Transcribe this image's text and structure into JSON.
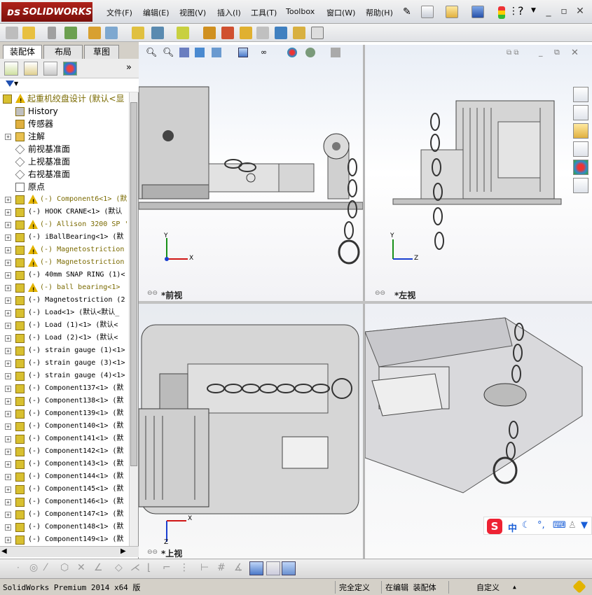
{
  "app": {
    "logo": "SOLIDWORKS",
    "menus": [
      "文件(F)",
      "编辑(E)",
      "视图(V)",
      "插入(I)",
      "工具(T)",
      "Toolbox",
      "窗口(W)",
      "帮助(H)"
    ],
    "window_controls": [
      "minimize-icon",
      "restore-icon",
      "close-icon"
    ]
  },
  "panel": {
    "tabs": [
      "装配体",
      "布局",
      "草图"
    ],
    "active_tab": "装配体",
    "collapse_symbol": "»"
  },
  "tree": [
    {
      "label": "起重机绞盘设计  (默认<显",
      "exp": "",
      "icon": "assembly",
      "warn": true,
      "color": "#7a6a00",
      "indent": 0
    },
    {
      "label": "History",
      "exp": "",
      "icon": "history",
      "warn": false,
      "color": "#000",
      "indent": 1
    },
    {
      "label": "传感器",
      "exp": "",
      "icon": "sensor",
      "warn": false,
      "color": "#000",
      "indent": 1
    },
    {
      "label": "注解",
      "exp": "+",
      "icon": "annotation",
      "warn": false,
      "color": "#000",
      "indent": 1
    },
    {
      "label": "前视基准面",
      "exp": "",
      "icon": "plane",
      "warn": false,
      "color": "#000",
      "indent": 1
    },
    {
      "label": "上视基准面",
      "exp": "",
      "icon": "plane",
      "warn": false,
      "color": "#000",
      "indent": 1
    },
    {
      "label": "右视基准面",
      "exp": "",
      "icon": "plane",
      "warn": false,
      "color": "#000",
      "indent": 1
    },
    {
      "label": "原点",
      "exp": "",
      "icon": "origin",
      "warn": false,
      "color": "#000",
      "indent": 1
    },
    {
      "label": "(-) Component6<1> (默",
      "exp": "+",
      "icon": "component",
      "warn": true,
      "color": "#7a6a00",
      "indent": 1
    },
    {
      "label": "(-) HOOK CRANE<1> (默认",
      "exp": "+",
      "icon": "component",
      "warn": false,
      "color": "#000",
      "indent": 1
    },
    {
      "label": "(-) Allison 3200 SP '",
      "exp": "+",
      "icon": "component",
      "warn": true,
      "color": "#7a6a00",
      "indent": 1
    },
    {
      "label": "(-) iBallBearing<1> (默",
      "exp": "+",
      "icon": "component",
      "warn": false,
      "color": "#000",
      "indent": 1
    },
    {
      "label": "(-) Magnetostriction",
      "exp": "+",
      "icon": "component",
      "warn": true,
      "color": "#7a6a00",
      "indent": 1
    },
    {
      "label": "(-) Magnetostriction",
      "exp": "+",
      "icon": "component",
      "warn": true,
      "color": "#7a6a00",
      "indent": 1
    },
    {
      "label": "(-) 40mm SNAP RING (1)<",
      "exp": "+",
      "icon": "component",
      "warn": false,
      "color": "#000",
      "indent": 1
    },
    {
      "label": "(-) ball bearing<1>",
      "exp": "+",
      "icon": "component",
      "warn": true,
      "color": "#7a6a00",
      "indent": 1
    },
    {
      "label": "(-) Magnetostriction (2",
      "exp": "+",
      "icon": "component",
      "warn": false,
      "color": "#000",
      "indent": 1
    },
    {
      "label": "(-) Load<1> (默认<默认_",
      "exp": "+",
      "icon": "component",
      "warn": false,
      "color": "#000",
      "indent": 1
    },
    {
      "label": "(-) Load (1)<1> (默认<",
      "exp": "+",
      "icon": "component",
      "warn": false,
      "color": "#000",
      "indent": 1
    },
    {
      "label": "(-) Load (2)<1> (默认<",
      "exp": "+",
      "icon": "component",
      "warn": false,
      "color": "#000",
      "indent": 1
    },
    {
      "label": "(-) strain gauge (1)<1>",
      "exp": "+",
      "icon": "component",
      "warn": false,
      "color": "#000",
      "indent": 1
    },
    {
      "label": "(-) strain gauge (3)<1>",
      "exp": "+",
      "icon": "component",
      "warn": false,
      "color": "#000",
      "indent": 1
    },
    {
      "label": "(-) strain gauge (4)<1>",
      "exp": "+",
      "icon": "component",
      "warn": false,
      "color": "#000",
      "indent": 1
    },
    {
      "label": "(-) Component137<1> (默",
      "exp": "+",
      "icon": "component",
      "warn": false,
      "color": "#000",
      "indent": 1
    },
    {
      "label": "(-) Component138<1> (默",
      "exp": "+",
      "icon": "component",
      "warn": false,
      "color": "#000",
      "indent": 1
    },
    {
      "label": "(-) Component139<1> (默",
      "exp": "+",
      "icon": "component",
      "warn": false,
      "color": "#000",
      "indent": 1
    },
    {
      "label": "(-) Component140<1> (默",
      "exp": "+",
      "icon": "component",
      "warn": false,
      "color": "#000",
      "indent": 1
    },
    {
      "label": "(-) Component141<1> (默",
      "exp": "+",
      "icon": "component",
      "warn": false,
      "color": "#000",
      "indent": 1
    },
    {
      "label": "(-) Component142<1> (默",
      "exp": "+",
      "icon": "component",
      "warn": false,
      "color": "#000",
      "indent": 1
    },
    {
      "label": "(-) Component143<1> (默",
      "exp": "+",
      "icon": "component",
      "warn": false,
      "color": "#000",
      "indent": 1
    },
    {
      "label": "(-) Component144<1> (默",
      "exp": "+",
      "icon": "component",
      "warn": false,
      "color": "#000",
      "indent": 1
    },
    {
      "label": "(-) Component145<1> (默",
      "exp": "+",
      "icon": "component",
      "warn": false,
      "color": "#000",
      "indent": 1
    },
    {
      "label": "(-) Component146<1> (默",
      "exp": "+",
      "icon": "component",
      "warn": false,
      "color": "#000",
      "indent": 1
    },
    {
      "label": "(-) Component147<1> (默",
      "exp": "+",
      "icon": "component",
      "warn": false,
      "color": "#000",
      "indent": 1
    },
    {
      "label": "(-) Component148<1> (默",
      "exp": "+",
      "icon": "component",
      "warn": false,
      "color": "#000",
      "indent": 1
    },
    {
      "label": "(-) Component149<1> (默",
      "exp": "+",
      "icon": "component",
      "warn": false,
      "color": "#000",
      "indent": 1
    }
  ],
  "viewports": {
    "front": "*前视",
    "left": "*左视",
    "top": "*上视"
  },
  "axes": {
    "x": "X",
    "y": "Y",
    "z": "Z"
  },
  "statusbar": {
    "version": "SolidWorks Premium 2014 x64 版",
    "state": "完全定义",
    "mode": "在编辑 装配体",
    "custom": "自定义",
    "arrow": "▲"
  },
  "ime": {
    "logo": "S",
    "lang": "中"
  },
  "colors": {
    "accent_red": "#b0221a",
    "warning": "#e3b400",
    "assembly_text": "#7a6a00",
    "axis_x": "#d01515",
    "axis_y": "#189018",
    "axis_z": "#1a3fd0"
  }
}
